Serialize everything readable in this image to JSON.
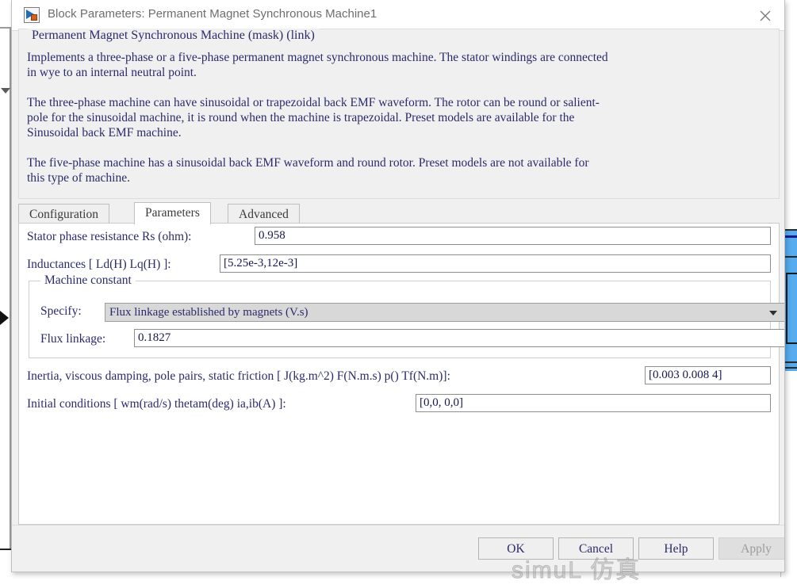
{
  "window": {
    "title": "Block Parameters: Permanent Magnet Synchronous Machine1",
    "icon": "simulink-block-icon",
    "close_label": "×"
  },
  "description": {
    "heading": "Permanent Magnet Synchronous Machine (mask) (link)",
    "body": "Implements a three-phase or a five-phase permanent magnet synchronous machine. The stator windings are connected\nin wye to an internal neutral point.\n\nThe three-phase machine can have sinusoidal or trapezoidal back EMF waveform. The rotor can be round or salient-\npole for the sinusoidal machine, it is round when the machine is trapezoidal. Preset models are available for the\nSinusoidal back EMF machine.\n\nThe five-phase machine has a sinusoidal back EMF waveform and round rotor. Preset models are not available for\nthis type of machine."
  },
  "tabs": [
    {
      "label": "Configuration",
      "active": false
    },
    {
      "label": "Parameters",
      "active": true
    },
    {
      "label": "Advanced",
      "active": false
    }
  ],
  "parameters": {
    "stator_resistance": {
      "label": "Stator phase resistance Rs (ohm):",
      "value": "0.958"
    },
    "inductances": {
      "label": "Inductances [ Ld(H) Lq(H) ]:",
      "value": "[5.25e-3,12e-3]"
    },
    "machine_constant": {
      "group_label": "Machine constant",
      "specify_label": "Specify:",
      "specify_value": "Flux linkage established by magnets (V.s)",
      "flux_label": "Flux linkage:",
      "flux_value": "0.1827"
    },
    "inertia": {
      "label": "Inertia, viscous damping, pole pairs, static friction [ J(kg.m^2)  F(N.m.s)  p()  Tf(N.m)]:",
      "value": "[0.003 0.008 4]"
    },
    "initial_conditions": {
      "label": "Initial conditions  [ wm(rad/s)  thetam(deg)  ia,ib(A) ]:",
      "value": "[0,0, 0,0]"
    }
  },
  "footer": {
    "ok": "OK",
    "cancel": "Cancel",
    "help": "Help",
    "apply": "Apply"
  },
  "watermark": {
    "text": "simuL 仿真"
  },
  "colors": {
    "text_blue": "#2b2b6b",
    "panel_bg": "#f0f0f0",
    "content_bg": "#ffffff",
    "combo_bg": "#d8d8d8",
    "accent_blue": "#56acee"
  }
}
